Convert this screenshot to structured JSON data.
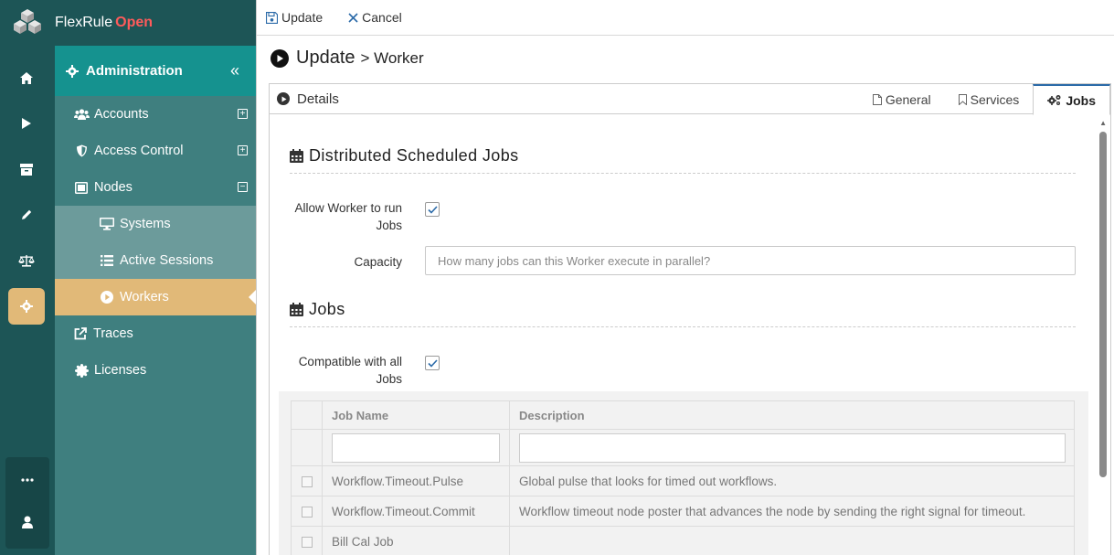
{
  "brand": {
    "name": "FlexRule",
    "edition": "Open"
  },
  "rail": {
    "items": [
      {
        "icon": "home-icon"
      },
      {
        "icon": "play-icon"
      },
      {
        "icon": "archive-icon"
      },
      {
        "icon": "pencil-icon"
      },
      {
        "icon": "scale-icon"
      },
      {
        "icon": "gear-icon",
        "active": true
      }
    ],
    "bottom": [
      {
        "icon": "more-icon"
      },
      {
        "icon": "user-icon"
      }
    ]
  },
  "sidebar": {
    "header": "Administration",
    "items": [
      {
        "label": "Accounts",
        "icon": "users-icon",
        "expander": "+"
      },
      {
        "label": "Access Control",
        "icon": "shield-icon",
        "expander": "+"
      },
      {
        "label": "Nodes",
        "icon": "sitemap-icon",
        "expander": "−"
      },
      {
        "label": "Systems",
        "icon": "monitor-icon"
      },
      {
        "label": "Active Sessions",
        "icon": "list-icon"
      },
      {
        "label": "Workers",
        "icon": "play-circle-icon",
        "active": true
      },
      {
        "label": "Traces",
        "icon": "external-link-icon"
      },
      {
        "label": "Licenses",
        "icon": "certificate-icon"
      }
    ]
  },
  "toolbar": {
    "update": "Update",
    "cancel": "Cancel"
  },
  "page": {
    "title": "Update",
    "subtitle": "> Worker"
  },
  "panel": {
    "details": "Details",
    "tabs": [
      {
        "label": "General"
      },
      {
        "label": "Services"
      },
      {
        "label": "Jobs",
        "active": true
      }
    ]
  },
  "form": {
    "section1": "Distributed Scheduled Jobs",
    "allow_label": "Allow Worker to run Jobs",
    "allow_checked": true,
    "capacity_label": "Capacity",
    "capacity_placeholder": "How many jobs can this Worker execute in parallel?",
    "section2": "Jobs",
    "compat_label": "Compatible with all Jobs",
    "compat_checked": true
  },
  "jobs_table": {
    "columns": [
      "Job Name",
      "Description"
    ],
    "rows": [
      {
        "name": "Workflow.Timeout.Pulse",
        "description": "Global pulse that looks for timed out workflows."
      },
      {
        "name": "Workflow.Timeout.Commit",
        "description": "Workflow timeout node poster that advances the node by sending the right signal for timeout."
      },
      {
        "name": "Bill Cal Job",
        "description": ""
      }
    ]
  },
  "colors": {
    "accent": "#15928f",
    "active": "#e1b978",
    "brand_open": "#ff5b5b"
  }
}
